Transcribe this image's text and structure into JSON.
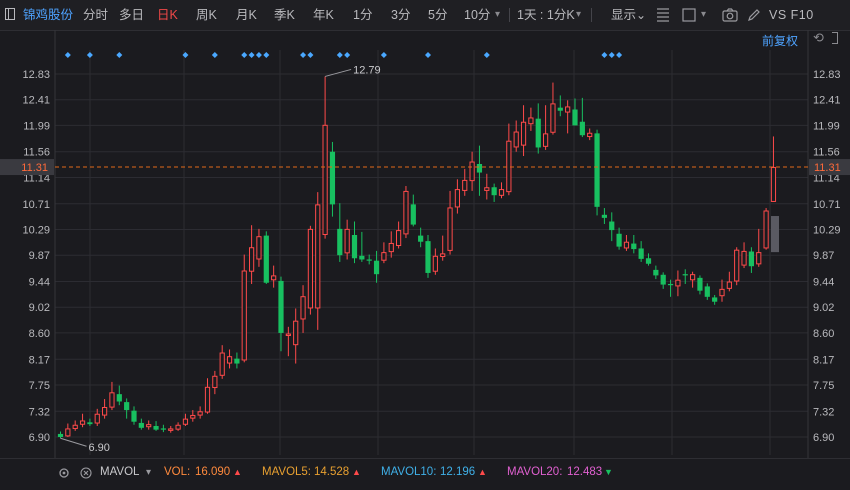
{
  "toolbar": {
    "stock_name": "锦鸡股份",
    "periods": [
      "分时",
      "多日",
      "日K",
      "周K",
      "月K",
      "季K",
      "年K",
      "1分",
      "3分",
      "5分",
      "10分"
    ],
    "active_period": "日K",
    "multi_day": "1天 : 1分K",
    "display": "显示",
    "vs_text": "VS F10"
  },
  "top_right": {
    "adjust": "前复权"
  },
  "icons": [
    "pane-icon",
    "chevron-down-icon",
    "grid-icon",
    "checkbox-icon",
    "camera-icon",
    "pencil-icon",
    "undo-icon",
    "settings-icon",
    "close-icon"
  ],
  "colors": {
    "up": "#ff4a4a",
    "down": "#18c060",
    "grid": "#2c2c32",
    "current": "#e06a1a",
    "marker": "#4aa8ff"
  },
  "chart_data": {
    "type": "candlestick",
    "y_ticks": [
      "12.83",
      "12.41",
      "11.99",
      "11.56",
      "11.14",
      "10.71",
      "10.29",
      "9.87",
      "9.44",
      "9.02",
      "8.60",
      "8.17",
      "7.75",
      "7.32",
      "6.90"
    ],
    "ylim": [
      6.9,
      12.83
    ],
    "current_price": "11.31",
    "high_label": "12.79",
    "low_label": "6.90",
    "markers": [
      1,
      4,
      8,
      17,
      21,
      25,
      26,
      27,
      28,
      33,
      34,
      38,
      39,
      44,
      50,
      58,
      74,
      75,
      76
    ],
    "candles": [
      [
        6.95,
        6.9,
        6.99,
        6.88
      ],
      [
        6.91,
        7.04,
        7.12,
        6.9
      ],
      [
        7.03,
        7.1,
        7.17,
        7.0
      ],
      [
        7.1,
        7.17,
        7.28,
        7.06
      ],
      [
        7.14,
        7.11,
        7.2,
        7.08
      ],
      [
        7.12,
        7.28,
        7.36,
        7.08
      ],
      [
        7.25,
        7.39,
        7.52,
        7.2
      ],
      [
        7.38,
        7.63,
        7.8,
        7.34
      ],
      [
        7.6,
        7.48,
        7.74,
        7.42
      ],
      [
        7.47,
        7.34,
        7.53,
        7.2
      ],
      [
        7.33,
        7.15,
        7.4,
        7.1
      ],
      [
        7.13,
        7.05,
        7.2,
        7.02
      ],
      [
        7.06,
        7.11,
        7.17,
        7.02
      ],
      [
        7.08,
        7.02,
        7.16,
        7.0
      ],
      [
        7.04,
        7.02,
        7.1,
        6.98
      ],
      [
        7.0,
        7.04,
        7.08,
        6.97
      ],
      [
        7.02,
        7.1,
        7.14,
        7.0
      ],
      [
        7.1,
        7.2,
        7.28,
        7.08
      ],
      [
        7.2,
        7.26,
        7.34,
        7.15
      ],
      [
        7.25,
        7.32,
        7.4,
        7.2
      ],
      [
        7.3,
        7.72,
        7.86,
        7.28
      ],
      [
        7.7,
        7.9,
        7.98,
        7.6
      ],
      [
        7.9,
        8.28,
        8.4,
        7.85
      ],
      [
        8.1,
        8.22,
        8.33,
        8.02
      ],
      [
        8.18,
        8.1,
        8.28,
        8.02
      ],
      [
        8.15,
        9.62,
        9.88,
        8.12
      ],
      [
        9.6,
        10.0,
        10.36,
        9.4
      ],
      [
        9.8,
        10.18,
        10.3,
        9.68
      ],
      [
        10.19,
        9.42,
        10.26,
        9.4
      ],
      [
        9.46,
        9.54,
        9.7,
        9.34
      ],
      [
        9.45,
        8.6,
        9.52,
        8.3
      ],
      [
        8.55,
        8.59,
        8.7,
        8.22
      ],
      [
        8.4,
        8.8,
        9.0,
        8.1
      ],
      [
        8.82,
        9.2,
        9.38,
        8.6
      ],
      [
        9.0,
        10.3,
        10.35,
        8.9
      ],
      [
        9.0,
        10.7,
        10.9,
        8.65
      ],
      [
        10.2,
        12.0,
        12.79,
        10.14
      ],
      [
        11.56,
        10.7,
        11.72,
        10.5
      ],
      [
        10.3,
        9.87,
        10.72,
        9.76
      ],
      [
        9.9,
        10.3,
        10.45,
        9.8
      ],
      [
        10.2,
        9.82,
        10.42,
        9.74
      ],
      [
        9.86,
        9.8,
        10.25,
        9.76
      ],
      [
        9.8,
        9.78,
        9.88,
        9.72
      ],
      [
        9.78,
        9.56,
        9.94,
        9.42
      ],
      [
        9.78,
        9.92,
        10.08,
        9.74
      ],
      [
        9.92,
        10.07,
        10.26,
        9.83
      ],
      [
        10.02,
        10.28,
        10.42,
        9.98
      ],
      [
        10.21,
        10.92,
        11.0,
        10.15
      ],
      [
        10.7,
        10.37,
        10.86,
        10.34
      ],
      [
        10.19,
        10.09,
        10.32,
        10.0
      ],
      [
        10.1,
        9.58,
        10.2,
        9.5
      ],
      [
        9.6,
        9.86,
        9.98,
        9.55
      ],
      [
        9.84,
        9.9,
        10.19,
        9.78
      ],
      [
        9.94,
        10.65,
        10.92,
        9.88
      ],
      [
        10.65,
        10.95,
        11.11,
        10.55
      ],
      [
        10.92,
        11.1,
        11.28,
        10.84
      ],
      [
        11.08,
        11.4,
        11.56,
        10.92
      ],
      [
        11.36,
        11.22,
        11.66,
        10.84
      ],
      [
        10.92,
        10.98,
        11.2,
        10.78
      ],
      [
        10.98,
        10.85,
        11.04,
        10.74
      ],
      [
        10.84,
        10.95,
        11.06,
        10.8
      ],
      [
        10.9,
        11.74,
        12.02,
        10.85
      ],
      [
        11.63,
        11.89,
        12.07,
        11.56
      ],
      [
        11.66,
        12.05,
        12.32,
        11.49
      ],
      [
        12.01,
        12.12,
        12.28,
        11.9
      ],
      [
        12.1,
        11.63,
        12.35,
        11.53
      ],
      [
        11.64,
        11.86,
        12.32,
        11.59
      ],
      [
        11.87,
        12.35,
        12.69,
        11.84
      ],
      [
        12.28,
        12.23,
        12.48,
        12.14
      ],
      [
        12.2,
        12.3,
        12.4,
        11.86
      ],
      [
        12.25,
        11.99,
        12.43,
        11.99
      ],
      [
        12.05,
        11.83,
        12.44,
        11.8
      ],
      [
        11.8,
        11.87,
        11.94,
        11.75
      ],
      [
        11.86,
        10.66,
        11.92,
        10.52
      ],
      [
        10.53,
        10.48,
        10.64,
        10.38
      ],
      [
        10.42,
        10.28,
        10.57,
        10.1
      ],
      [
        10.22,
        10.01,
        10.32,
        9.96
      ],
      [
        9.98,
        10.09,
        10.2,
        9.94
      ],
      [
        10.06,
        9.97,
        10.2,
        9.9
      ],
      [
        9.98,
        9.81,
        10.1,
        9.76
      ],
      [
        9.82,
        9.73,
        9.9,
        9.7
      ],
      [
        9.63,
        9.54,
        9.7,
        9.48
      ],
      [
        9.55,
        9.39,
        9.59,
        9.32
      ],
      [
        9.4,
        9.38,
        9.47,
        9.19
      ],
      [
        9.36,
        9.47,
        9.62,
        9.2
      ],
      [
        9.56,
        9.54,
        9.64,
        9.4
      ],
      [
        9.46,
        9.56,
        9.6,
        9.34
      ],
      [
        9.5,
        9.29,
        9.54,
        9.23
      ],
      [
        9.36,
        9.19,
        9.41,
        9.14
      ],
      [
        9.18,
        9.11,
        9.22,
        9.06
      ],
      [
        9.2,
        9.32,
        9.47,
        9.11
      ],
      [
        9.32,
        9.44,
        9.6,
        9.28
      ],
      [
        9.44,
        9.96,
        10.0,
        9.38
      ],
      [
        9.7,
        9.94,
        10.08,
        9.66
      ],
      [
        9.93,
        9.69,
        10.0,
        9.58
      ],
      [
        9.72,
        9.92,
        10.3,
        9.68
      ],
      [
        9.98,
        10.6,
        10.64,
        9.96
      ],
      [
        10.74,
        11.31,
        11.81,
        10.74
      ]
    ]
  },
  "indicator": {
    "name": "MAVOL",
    "vol_label": "VOL:",
    "vol_value": "16.090",
    "mavol5_label": "MAVOL5:",
    "mavol5_value": "14.528",
    "mavol10_label": "MAVOL10:",
    "mavol10_value": "12.196",
    "mavol20_label": "MAVOL20:",
    "mavol20_value": "12.483"
  }
}
